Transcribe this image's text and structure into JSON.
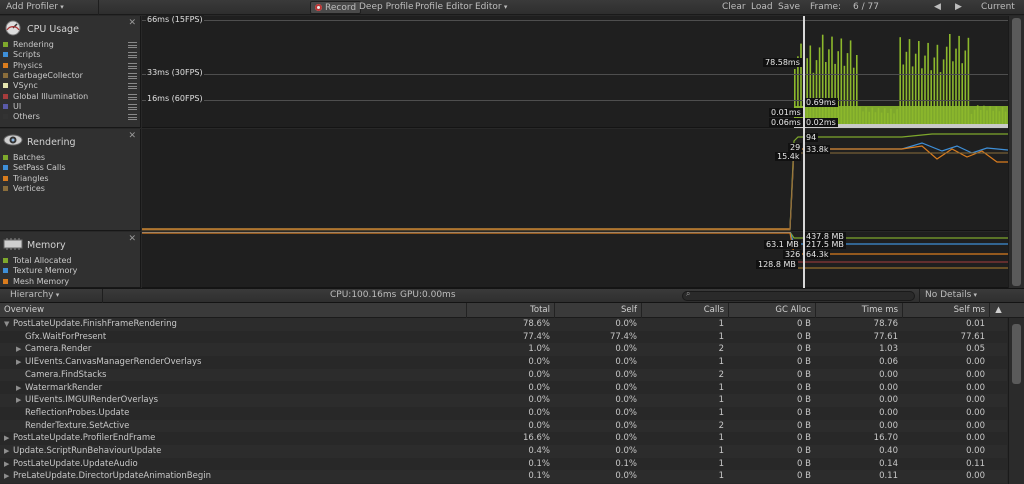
{
  "toolbar": {
    "add_profiler": "Add Profiler",
    "record": "Record",
    "deep_profile": "Deep Profile",
    "profiler_editor": "Profile Editor",
    "editor": "Editor",
    "clear": "Clear",
    "load": "Load",
    "save": "Save",
    "frame_label": "Frame:",
    "frame_value": "6 / 77",
    "prev": "◀",
    "next": "▶",
    "current": "Current"
  },
  "modules": {
    "cpu": {
      "title": "CPU Usage",
      "legend": [
        {
          "label": "Rendering",
          "color": "#7ea82c"
        },
        {
          "label": "Scripts",
          "color": "#3e8fd8"
        },
        {
          "label": "Physics",
          "color": "#d97c1e"
        },
        {
          "label": "GarbageCollector",
          "color": "#8a6d3b"
        },
        {
          "label": "VSync",
          "color": "#e5e5b0"
        },
        {
          "label": "Global Illumination",
          "color": "#a63c3c"
        },
        {
          "label": "UI",
          "color": "#5a5aa8"
        },
        {
          "label": "Others",
          "color": "#333333"
        }
      ],
      "grid": [
        "66ms (15FPS)",
        "33ms (30FPS)",
        "16ms (60FPS)"
      ],
      "values": {
        "a": "78.58ms",
        "b": "0.69ms",
        "c": "0.01ms",
        "d": "0.06ms",
        "e": "0.02ms"
      }
    },
    "rendering": {
      "title": "Rendering",
      "legend": [
        {
          "label": "Batches",
          "color": "#7ea82c"
        },
        {
          "label": "SetPass Calls",
          "color": "#3e8fd8"
        },
        {
          "label": "Triangles",
          "color": "#d97c1e"
        },
        {
          "label": "Vertices",
          "color": "#8a6d3b"
        }
      ],
      "values": {
        "a": "94",
        "b": "29",
        "c": "33.8k",
        "d": "15.4k"
      }
    },
    "memory": {
      "title": "Memory",
      "legend": [
        {
          "label": "Total Allocated",
          "color": "#7ea82c"
        },
        {
          "label": "Texture Memory",
          "color": "#3e8fd8"
        },
        {
          "label": "Mesh Memory",
          "color": "#d97c1e"
        }
      ],
      "values": {
        "a": "437.8 MB",
        "b": "63.1 MB",
        "c": "217.5 MB",
        "d": "326",
        "e": "64.3k",
        "f": "128.8 MB"
      }
    }
  },
  "hierarchy_bar": {
    "view": "Hierarchy",
    "cpu": "CPU:100.16ms",
    "gpu": "GPU:0.00ms",
    "details": "No Details"
  },
  "columns": [
    "Overview",
    "Total",
    "Self",
    "Calls",
    "GC Alloc",
    "Time ms",
    "Self ms",
    "▲"
  ],
  "rows": [
    {
      "name": "PostLateUpdate.FinishFrameRendering",
      "tri": "▼",
      "total": "78.6%",
      "self": "0.0%",
      "calls": "1",
      "gc": "0 B",
      "time": "78.76",
      "selfms": "0.01"
    },
    {
      "name": "Gfx.WaitForPresent",
      "tri": "",
      "total": "77.4%",
      "self": "77.4%",
      "calls": "1",
      "gc": "0 B",
      "time": "77.61",
      "selfms": "77.61"
    },
    {
      "name": "Camera.Render",
      "tri": "▶",
      "total": "1.0%",
      "self": "0.0%",
      "calls": "2",
      "gc": "0 B",
      "time": "1.03",
      "selfms": "0.05"
    },
    {
      "name": "UIEvents.CanvasManagerRenderOverlays",
      "tri": "▶",
      "total": "0.0%",
      "self": "0.0%",
      "calls": "1",
      "gc": "0 B",
      "time": "0.06",
      "selfms": "0.00"
    },
    {
      "name": "Camera.FindStacks",
      "tri": "",
      "total": "0.0%",
      "self": "0.0%",
      "calls": "2",
      "gc": "0 B",
      "time": "0.00",
      "selfms": "0.00"
    },
    {
      "name": "WatermarkRender",
      "tri": "▶",
      "total": "0.0%",
      "self": "0.0%",
      "calls": "1",
      "gc": "0 B",
      "time": "0.00",
      "selfms": "0.00"
    },
    {
      "name": "UIEvents.IMGUIRenderOverlays",
      "tri": "▶",
      "total": "0.0%",
      "self": "0.0%",
      "calls": "1",
      "gc": "0 B",
      "time": "0.00",
      "selfms": "0.00"
    },
    {
      "name": "ReflectionProbes.Update",
      "tri": "",
      "total": "0.0%",
      "self": "0.0%",
      "calls": "1",
      "gc": "0 B",
      "time": "0.00",
      "selfms": "0.00"
    },
    {
      "name": "RenderTexture.SetActive",
      "tri": "",
      "total": "0.0%",
      "self": "0.0%",
      "calls": "2",
      "gc": "0 B",
      "time": "0.00",
      "selfms": "0.00"
    },
    {
      "name": "PostLateUpdate.ProfilerEndFrame",
      "tri": "▶",
      "total": "16.6%",
      "self": "0.0%",
      "calls": "1",
      "gc": "0 B",
      "time": "16.70",
      "selfms": "0.00"
    },
    {
      "name": "Update.ScriptRunBehaviourUpdate",
      "tri": "▶",
      "total": "0.4%",
      "self": "0.0%",
      "calls": "1",
      "gc": "0 B",
      "time": "0.40",
      "selfms": "0.00"
    },
    {
      "name": "PostLateUpdate.UpdateAudio",
      "tri": "▶",
      "total": "0.1%",
      "self": "0.1%",
      "calls": "1",
      "gc": "0 B",
      "time": "0.14",
      "selfms": "0.11"
    },
    {
      "name": "PreLateUpdate.DirectorUpdateAnimationBegin",
      "tri": "▶",
      "total": "0.1%",
      "self": "0.0%",
      "calls": "1",
      "gc": "0 B",
      "time": "0.11",
      "selfms": "0.00"
    }
  ]
}
